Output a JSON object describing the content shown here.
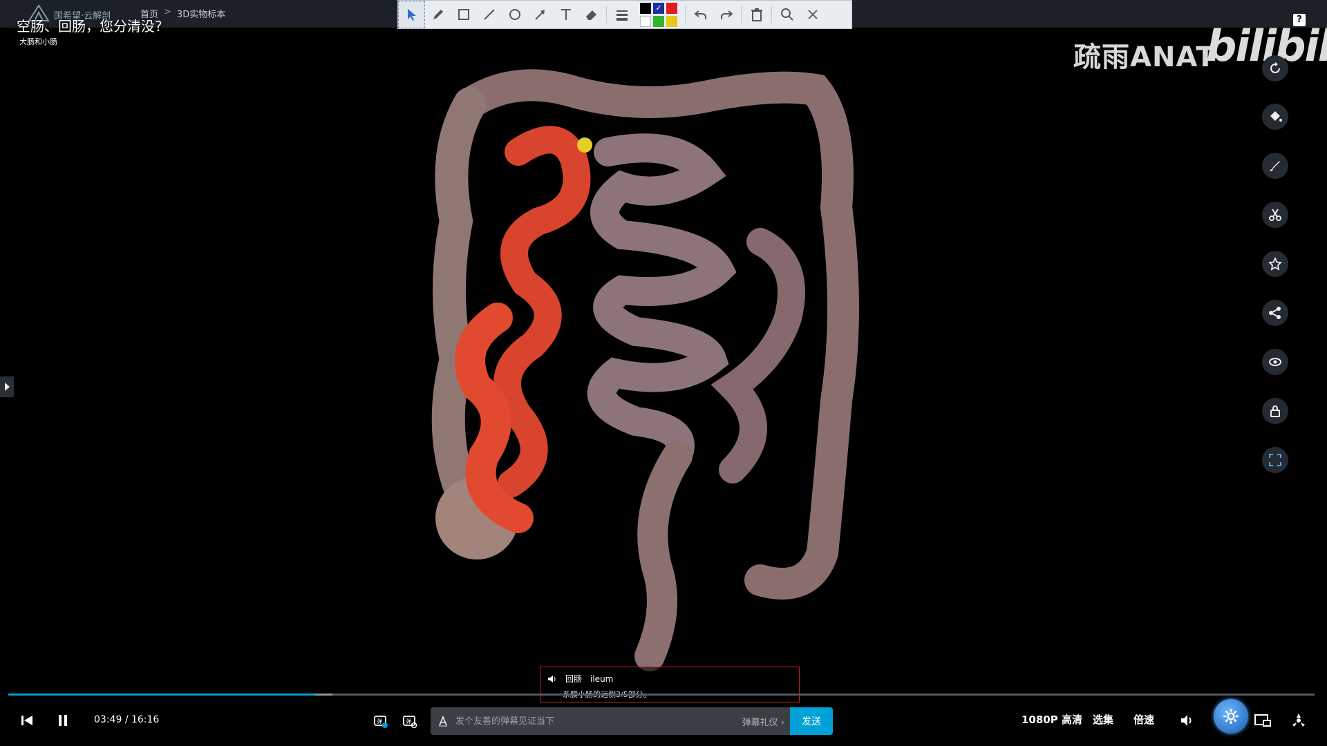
{
  "nav": {
    "brand": "国希望·云解剖",
    "crumb_home": "首页",
    "crumb_sep": ">",
    "crumb_current": "3D实物标本"
  },
  "video": {
    "title": "空肠、回肠，您分清没?",
    "subtitle": "大肠和小肠"
  },
  "toolbar": {
    "tools": [
      "select-icon",
      "pencil-icon",
      "rectangle-icon",
      "line-icon",
      "circle-icon",
      "arrow-icon",
      "text-icon",
      "eraser-icon",
      "line-width-icon"
    ],
    "palette": [
      "#000000",
      "#1e2fa0",
      "#e01c1c",
      "#ffffff",
      "#2fb52f",
      "#e5c81a"
    ],
    "actions": [
      "undo-icon",
      "redo-icon",
      "trash-icon",
      "zoom-icon",
      "close-icon"
    ]
  },
  "watermark": {
    "text": "疏雨ANAT",
    "logo": "bilibili"
  },
  "help": "?",
  "rail": [
    "rotate-icon",
    "paint-bucket-icon",
    "brush-icon",
    "scissors-icon",
    "star-icon",
    "share-icon",
    "eye-icon",
    "lock-icon",
    "fullscreen-icon"
  ],
  "tooltip": {
    "name_cn": "回肠",
    "name_en": "ileum",
    "desc": "系膜小肠的远侧3/5部分。"
  },
  "player": {
    "current_time": "03:49",
    "separator": "/",
    "duration": "16:16",
    "progress": 0.2345,
    "buffered": 0.248,
    "danmu_placeholder": "发个友善的弹幕见证当下",
    "danmu_etiquette": "弹幕礼仪 ›",
    "send_label": "发送",
    "quality_label": "1080P 高清",
    "episodes_label": "选集",
    "speed_label": "倍速"
  },
  "colors": {
    "accent": "#00a1d6",
    "tooltip_border": "#c9202a"
  }
}
